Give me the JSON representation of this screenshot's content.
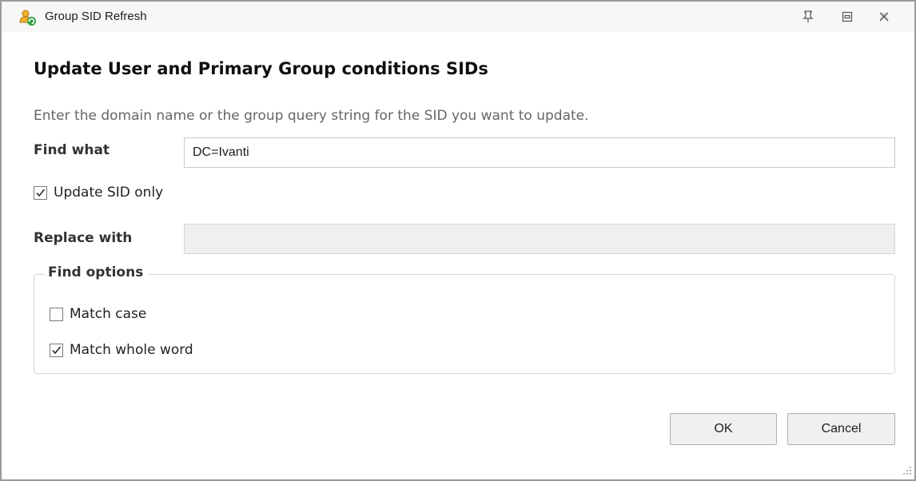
{
  "window": {
    "title": "Group SID Refresh",
    "icons": {
      "app": "group-refresh-icon",
      "pin": "pin-icon",
      "restore": "restore-icon",
      "close": "close-icon"
    }
  },
  "dialog": {
    "heading": "Update User and Primary Group conditions SIDs",
    "instruction": "Enter the domain name or the group query string for the SID you want to update.",
    "find_label": "Find what",
    "find_value": "DC=Ivanti",
    "update_sid_label": "Update SID only",
    "update_sid_checked": true,
    "replace_label": "Replace with",
    "replace_value": "",
    "replace_disabled": true,
    "find_options": {
      "legend": "Find options",
      "match_case_label": "Match case",
      "match_case_checked": false,
      "match_whole_word_label": "Match whole word",
      "match_whole_word_checked": true
    }
  },
  "buttons": {
    "ok": "OK",
    "cancel": "Cancel"
  },
  "colors": {
    "title_bar": "#f7f7f7",
    "border": "#9a9a9a",
    "disabled_field": "#efefef",
    "button": "#f0f0f0"
  }
}
